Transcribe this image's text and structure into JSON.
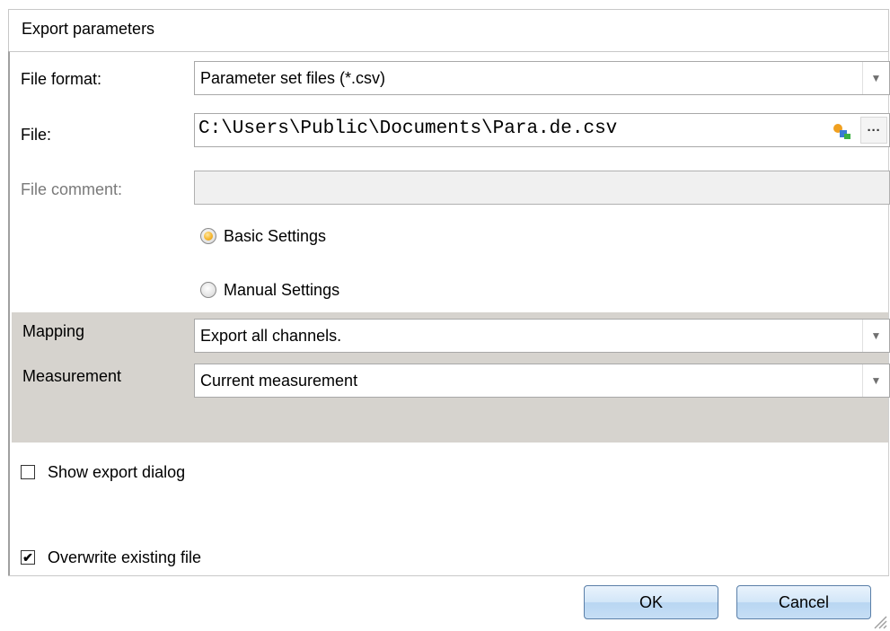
{
  "window": {
    "title": "Export parameters"
  },
  "form": {
    "file_format": {
      "label": "File format:",
      "value": "Parameter set files (*.csv)"
    },
    "file": {
      "label": "File:",
      "value": "C:\\Users\\Public\\Documents\\Para.de.csv",
      "browse_label": "···"
    },
    "file_comment": {
      "label": "File comment:",
      "value": ""
    },
    "settings_mode": {
      "options": [
        {
          "label": "Basic Settings",
          "selected": true
        },
        {
          "label": "Manual Settings",
          "selected": false
        }
      ]
    },
    "mapping": {
      "label": "Mapping",
      "value": "Export all channels."
    },
    "measurement": {
      "label": "Measurement",
      "value": "Current measurement"
    },
    "show_export_dialog": {
      "label": "Show export dialog",
      "checked": false
    },
    "overwrite_existing_file": {
      "label": "Overwrite existing file",
      "checked": true
    }
  },
  "buttons": {
    "ok": "OK",
    "cancel": "Cancel"
  },
  "icons": {
    "dropdown": "chevron-down-icon",
    "picker": "document-picker-icon",
    "browse": "ellipsis-icon",
    "resize": "resize-grip-icon",
    "check": "checkmark-icon"
  },
  "colors": {
    "panel_gray": "#d6d3ce",
    "radio_selected": "#f5b731",
    "button_border": "#5a7fa8"
  }
}
